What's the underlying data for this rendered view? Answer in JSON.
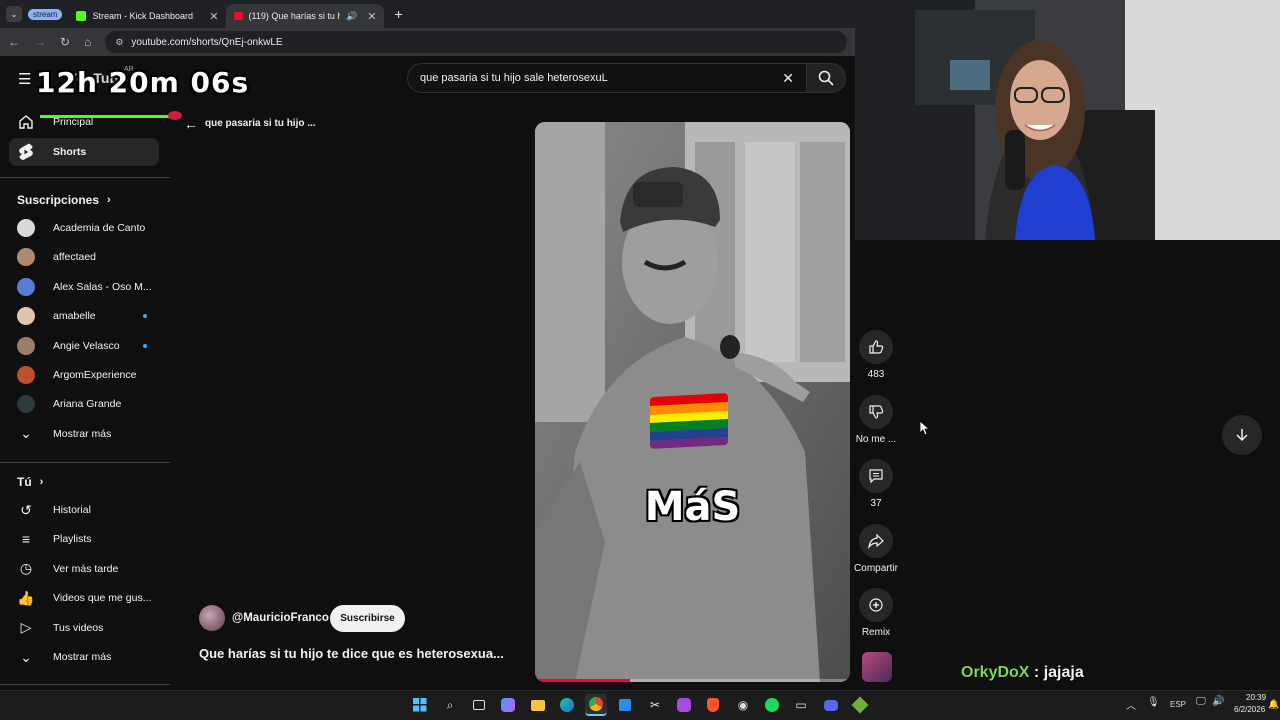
{
  "browser": {
    "tab_group": "stream",
    "tabs": [
      {
        "title": "Stream - Kick Dashboard"
      },
      {
        "title": "(119) Que harías si tu hijo te"
      }
    ],
    "url": "youtube.com/shorts/QnEj-onkwLE"
  },
  "overlay": {
    "timer": "12h 20m 06s",
    "chat_user": "OrkyDoX",
    "chat_sep": " : ",
    "chat_message": "jajaja"
  },
  "youtube": {
    "logo_text": "YouTube",
    "logo_region": "AR",
    "search_query": "que pasaria si tu hijo sale heterosexuL",
    "back_label": "que pasaria si tu hijo ...",
    "sidebar": {
      "main": [
        {
          "label": "Principal",
          "icon": "home-icon"
        },
        {
          "label": "Shorts",
          "icon": "shorts-icon"
        }
      ],
      "subs_title": "Suscripciones",
      "subs": [
        {
          "label": "Academia de Canto",
          "color": "#d9d9d9",
          "dot": false
        },
        {
          "label": "affectaed",
          "color": "#b08a6a",
          "dot": false
        },
        {
          "label": "Alex Salas - Oso M...",
          "color": "#5a7bd6",
          "dot": false
        },
        {
          "label": "amabelle",
          "color": "#e0c3b0",
          "dot": true
        },
        {
          "label": "Angie Velasco",
          "color": "#9c7d6a",
          "dot": true
        },
        {
          "label": "ArgomExperience",
          "color": "#c0502c",
          "dot": false
        },
        {
          "label": "Ariana Grande",
          "color": "#2a3b3a",
          "dot": false
        },
        {
          "label": "Mostrar más",
          "color": "",
          "dot": false
        }
      ],
      "you_title": "Tú",
      "you": [
        {
          "label": "Historial",
          "icon": "history-icon"
        },
        {
          "label": "Playlists",
          "icon": "playlists-icon"
        },
        {
          "label": "Ver más tarde",
          "icon": "watch-later-icon"
        },
        {
          "label": "Videos que me gus...",
          "icon": "liked-videos-icon"
        },
        {
          "label": "Tus videos",
          "icon": "your-videos-icon"
        },
        {
          "label": "Mostrar más",
          "icon": "chevron-down-icon"
        }
      ]
    },
    "short": {
      "channel": "@MauricioFranco",
      "subscribe": "Suscribirse",
      "title": "Que harías si tu hijo te dice que es heterosexua...",
      "caption": "MáS",
      "actions": {
        "likes": "483",
        "dislike": "No me ...",
        "comments": "37",
        "share": "Compartir",
        "remix": "Remix"
      }
    }
  },
  "taskbar": {
    "lang": "ESP",
    "time": "20:39",
    "date": "6/2/2026"
  },
  "colors": {
    "chat_user": "#7cd957",
    "accent_red": "#ff0033"
  }
}
